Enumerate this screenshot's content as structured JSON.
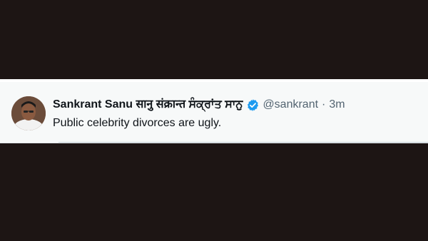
{
  "tweet": {
    "display_name": "Sankrant Sanu सानु संक्रान्त ਸੰਕ੍ਰਾਂਤ ਸਾਨੁ",
    "handle": "@sankrant",
    "separator": "·",
    "timestamp": "3m",
    "text": "Public celebrity divorces are ugly.",
    "verified": true
  },
  "colors": {
    "background": "#1d1514",
    "card": "#f7f9f9",
    "verified_badge": "#1d9bf0",
    "secondary_text": "#536471"
  },
  "icons": {
    "verified": "verified-badge-icon",
    "avatar": "profile-photo"
  }
}
